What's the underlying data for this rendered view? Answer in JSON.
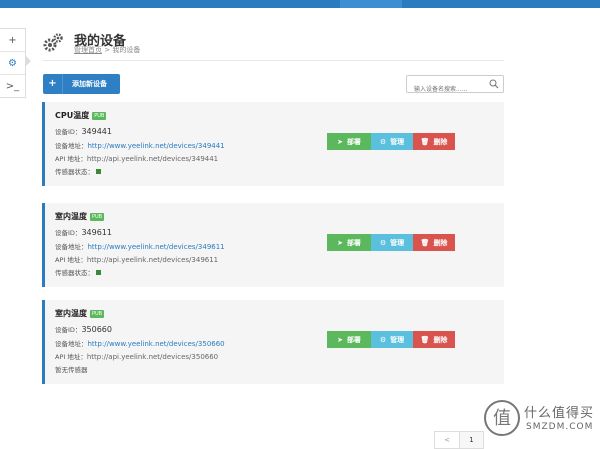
{
  "sidebar": {
    "items": [
      {
        "icon": "plus-icon",
        "glyph": "+"
      },
      {
        "icon": "gears-icon",
        "glyph": "⚙"
      },
      {
        "icon": "terminal-icon",
        "glyph": ">_"
      }
    ]
  },
  "header": {
    "title": "我的设备",
    "breadcrumb_home": "管理首页",
    "breadcrumb_sep": ">",
    "breadcrumb_current": "我的设备"
  },
  "toolbar": {
    "add_label": "添加新设备",
    "search_placeholder": "输入设备名搜索......"
  },
  "labels": {
    "device_id": "设备ID：",
    "device_url": "设备地址：",
    "api_url": "API 地址：",
    "sensor_status": "传感器状态：",
    "no_sensor": "暂无传感器",
    "badge": "PUB",
    "deploy": "部署",
    "manage": "管理",
    "delete": "删除"
  },
  "devices": [
    {
      "name": "CPU温度",
      "id": "349441",
      "url": "http://www.yeelink.net/devices/349441",
      "api": "http://api.yeelink.net/devices/349441",
      "has_sensor": true
    },
    {
      "name": "室内温度",
      "id": "349611",
      "url": "http://www.yeelink.net/devices/349611",
      "api": "http://api.yeelink.net/devices/349611",
      "has_sensor": true
    },
    {
      "name": "室内温度",
      "id": "350660",
      "url": "http://www.yeelink.net/devices/350660",
      "api": "http://api.yeelink.net/devices/350660",
      "has_sensor": false
    }
  ],
  "pagination": {
    "prev": "<",
    "current": "1"
  },
  "watermark": {
    "cn": "什么值得买",
    "en": "SMZDM.COM"
  },
  "colors": {
    "primary": "#2a7bc0",
    "deploy": "#5cb85c",
    "manage": "#5bc0de",
    "delete": "#d9534f"
  }
}
